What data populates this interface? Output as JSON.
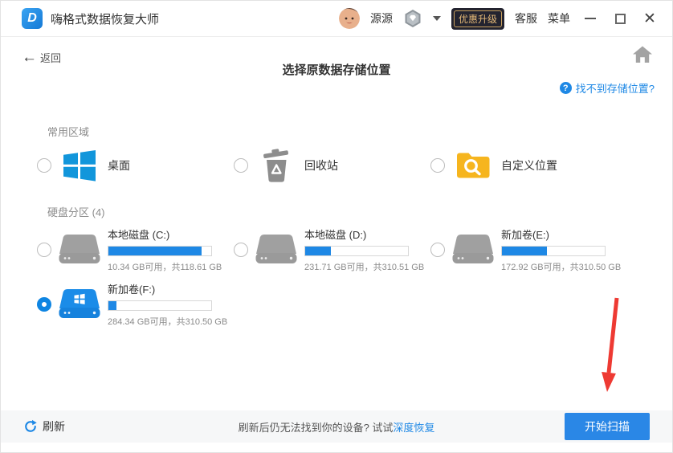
{
  "colors": {
    "accent": "#1e88e5",
    "arrow_red": "#ee3a33",
    "badge_gold": "#e3b877",
    "folder_yellow": "#f6b51e",
    "windows_blue": "#1296db"
  },
  "titlebar": {
    "app_title": "嗨格式数据恢复大师",
    "username": "源源",
    "upgrade_badge": "优惠升级",
    "support": "客服",
    "menu": "菜单"
  },
  "toolbar": {
    "back": "返回",
    "help_link": "找不到存储位置?"
  },
  "page": {
    "title": "选择原数据存储位置"
  },
  "common_section": {
    "label": "常用区域",
    "items": [
      {
        "label": "桌面",
        "icon": "windows-logo-icon"
      },
      {
        "label": "回收站",
        "icon": "recycle-bin-icon"
      },
      {
        "label": "自定义位置",
        "icon": "folder-search-icon"
      }
    ]
  },
  "partition_section": {
    "label": "硬盘分区 (4)",
    "drives": [
      {
        "name": "本地磁盘 (C:)",
        "info": "10.34 GB可用，共118.61 GB",
        "used_pct": 91,
        "selected": false
      },
      {
        "name": "本地磁盘 (D:)",
        "info": "231.71 GB可用，共310.51 GB",
        "used_pct": 25,
        "selected": false
      },
      {
        "name": "新加卷(E:)",
        "info": "172.92 GB可用，共310.50 GB",
        "used_pct": 44,
        "selected": false
      },
      {
        "name": "新加卷(F:)",
        "info": "284.34 GB可用，共310.50 GB",
        "used_pct": 8,
        "selected": true
      }
    ]
  },
  "footer": {
    "refresh": "刷新",
    "hint_text": "刷新后仍无法找到你的设备? 试试",
    "hint_link": "深度恢复",
    "scan_button": "开始扫描"
  }
}
